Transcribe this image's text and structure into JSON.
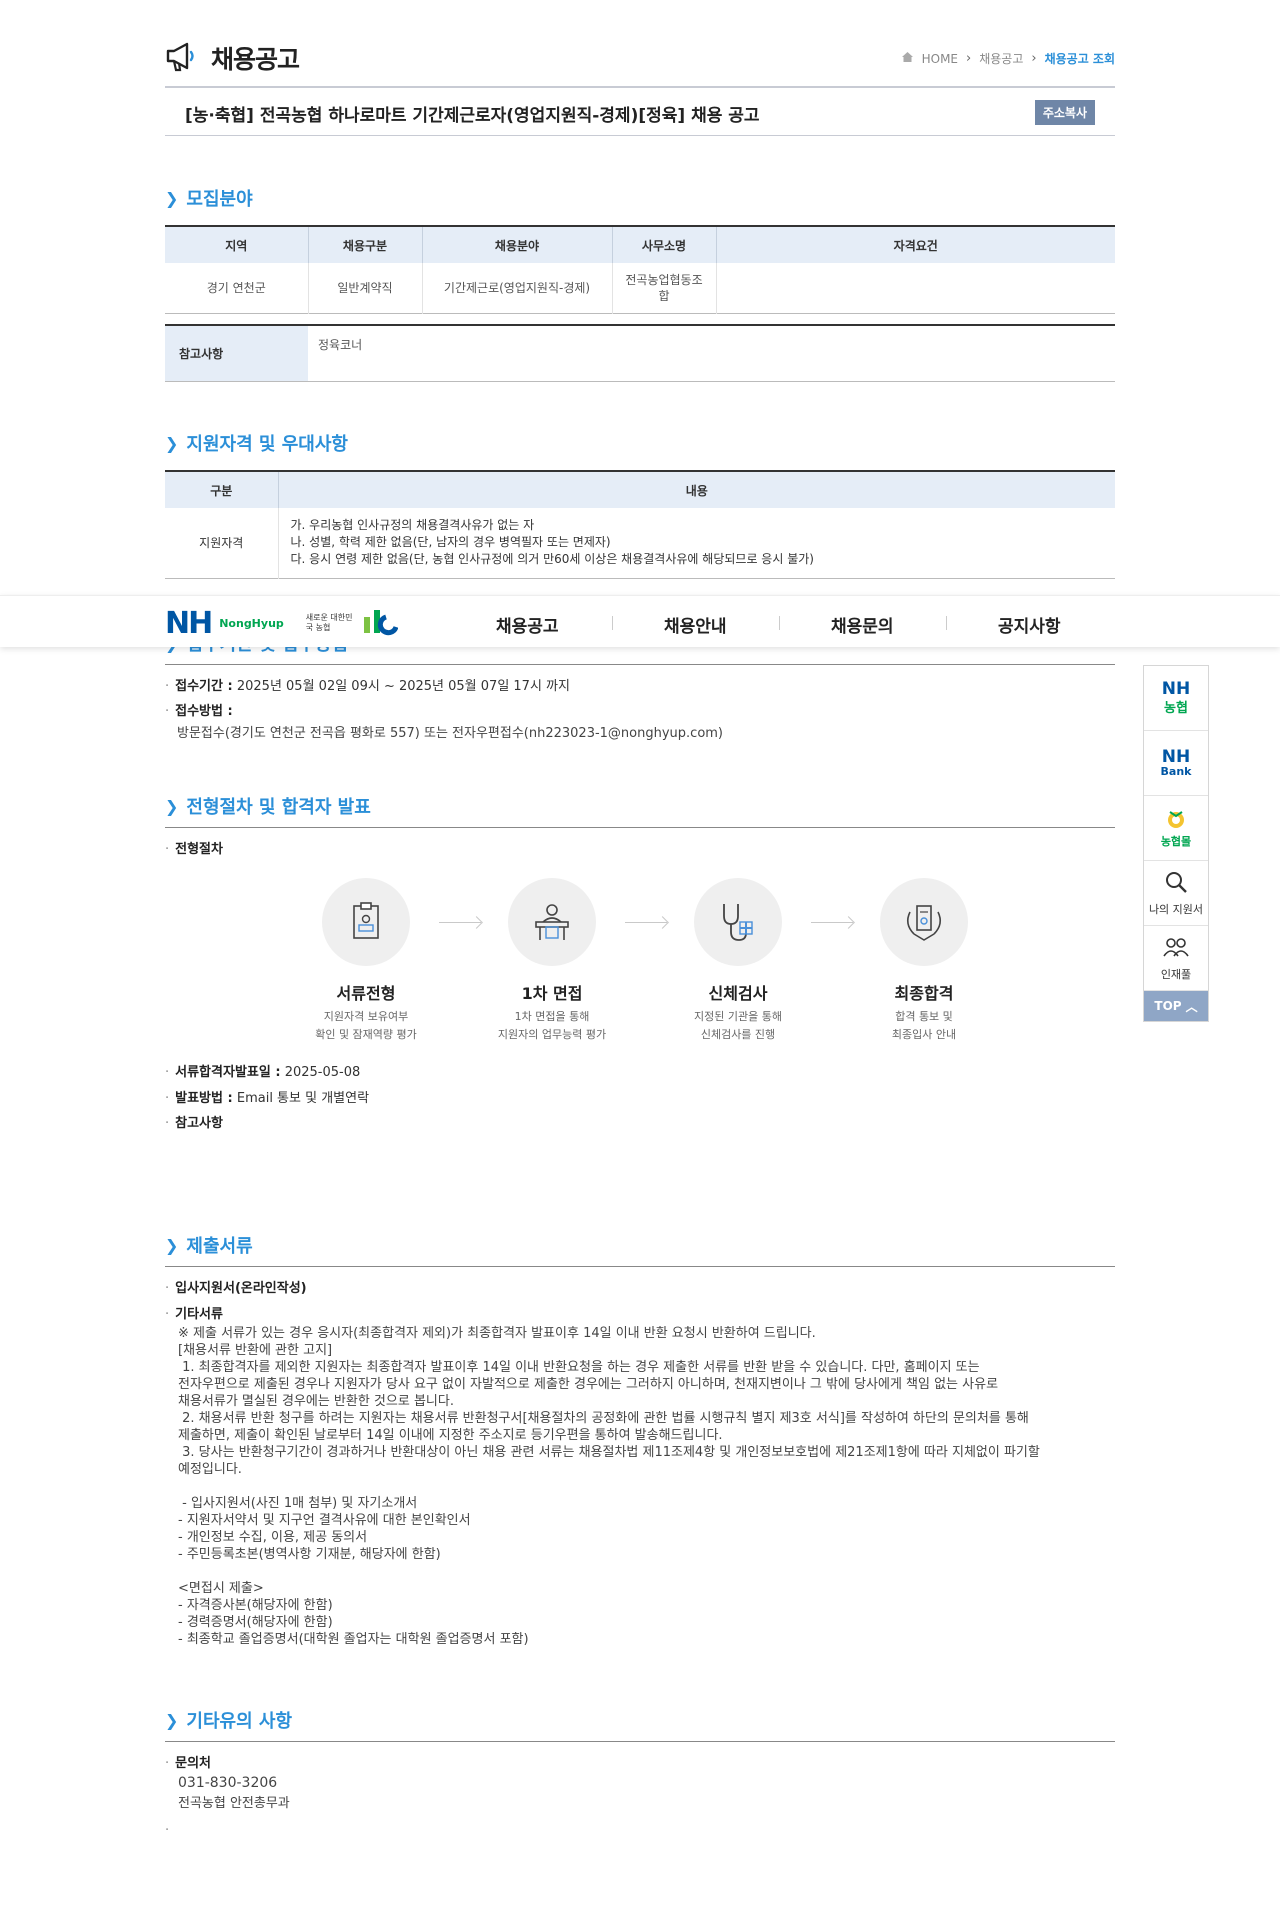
{
  "header": {
    "title": "채용공고",
    "breadcrumb": [
      "HOME",
      "채용공고",
      "채용공고 조회"
    ]
  },
  "job": {
    "title": "[농·축협] 전곡농협 하나로마트 기간제근로자(영업지원직-경제)[정육] 채용 공고",
    "copy_label": "주소복사"
  },
  "recruit": {
    "heading": "모집분야",
    "columns": [
      "지역",
      "채용구분",
      "채용분야",
      "사무소명",
      "자격요건"
    ],
    "row": [
      "경기 연천군",
      "일반계약직",
      "기간제근로(영업지원직-경제)",
      "전곡농업협동조\n합",
      ""
    ],
    "note_label": "참고사항",
    "note_value": "정육코너"
  },
  "qualification": {
    "heading": "지원자격 및 우대사항",
    "columns": [
      "구분",
      "내용"
    ],
    "row_label": "지원자격",
    "lines": [
      "가. 우리농협 인사규정의 채용결격사유가 없는 자",
      "나. 성별, 학력 제한 없음(단, 남자의 경우 병역필자 또는 면제자)",
      "다. 응시 연령 제한 없음(단, 농협 인사규정에 의거 만60세 이상은 채용결격사유에 해당되므로 응시 불가)"
    ]
  },
  "gnb": {
    "brand": "NongHyup",
    "slogan": "새로운 대한민국 농협",
    "items": [
      "채용공고",
      "채용안내",
      "채용문의",
      "공지사항"
    ]
  },
  "apply": {
    "heading": "접수기간 및 접수방법",
    "period_label": "접수기간 :",
    "period_value": "2025년 05월 02일 09시 ~ 2025년 05월 07일 17시 까지",
    "method_label": "접수방법 :",
    "method_value": "방문접수(경기도 연천군 전곡읍 평화로 557) 또는 전자우편접수(nh223023-1@nonghyup.com)"
  },
  "process": {
    "heading": "전형절차 및 합격자 발표",
    "label": "전형절차",
    "steps": [
      {
        "title": "서류전형",
        "desc1": "지원자격 보유여부",
        "desc2": "확인 및 잠재역량 평가"
      },
      {
        "title": "1차 면접",
        "desc1": "1차 면접을 통해",
        "desc2": "지원자의 업무능력 평가"
      },
      {
        "title": "신체검사",
        "desc1": "지정된 기관을 통해",
        "desc2": "신체검사를 진행"
      },
      {
        "title": "최종합격",
        "desc1": "합격 통보 및",
        "desc2": "최종입사 안내"
      }
    ],
    "announce_label": "서류합격자발표일 :",
    "announce_value": "2025-05-08",
    "method_label": "발표방법 :",
    "method_value": "Email 통보 및 개별연락",
    "note_label": "참고사항"
  },
  "documents": {
    "heading": "제출서류",
    "item1": "입사지원서(온라인작성)",
    "item2": "기타서류",
    "body": "※ 제출 서류가 있는 경우 응시자(최종합격자 제외)가 최종합격자 발표이후 14일 이내 반환 요청시 반환하여 드립니다.\n[채용서류 반환에 관한 고지]\n 1. 최종합격자를 제외한 지원자는 최종합격자 발표이후 14일 이내 반환요청을 하는 경우 제출한 서류를 반환 받을 수 있습니다. 다만, 홈페이지 또는\n전자우편으로 제출된 경우나 지원자가 당사 요구 없이 자발적으로 제출한 경우에는 그러하지 아니하며, 천재지변이나 그 밖에 당사에게 책임 없는 사유로\n채용서류가 멸실된 경우에는 반환한 것으로 봅니다.\n 2. 채용서류 반환 청구를 하려는 지원자는 채용서류 반환청구서[채용절차의 공정화에 관한 법률 시행규칙 별지 제3호 서식]를 작성하여 하단의 문의처를 통해\n제출하면, 제출이 확인된 날로부터 14일 이내에 지정한 주소지로 등기우편을 통하여 발송해드립니다.\n 3. 당사는 반환청구기간이 경과하거나 반환대상이 아닌 채용 관련 서류는 채용절차법 제11조제4항 및 개인정보보호법에 제21조제1항에 따라 지체없이 파기할\n예정입니다.\n\n - 입사지원서(사진 1매 첨부) 및 자기소개서\n- 지원자서약서 및 지구언 결격사유에 대한 본인확인서\n- 개인정보 수집, 이용, 제공 동의서\n- 주민등록초본(병역사항 기재분, 해당자에 한함)\n\n<면접시 제출>\n- 자격증사본(해당자에 한함)\n- 경력증명서(해당자에 한함)\n- 최종학교 졸업증명서(대학원 졸업자는 대학원 졸업증명서 포함)"
  },
  "etc": {
    "heading": "기타유의 사항",
    "contact_label": "문의처",
    "phone": "031-830-3206",
    "dept": "전곡농협 안전총무과"
  },
  "quick": {
    "items": [
      "NH\n농협",
      "NH\nBank",
      "농협몰",
      "나의 지원서",
      "인재풀"
    ],
    "top_label": "TOP"
  },
  "colors": {
    "accent": "#2b8fd8",
    "table_head": "#e5edf7",
    "nh_blue": "#0056a4",
    "nh_green": "#00a651"
  }
}
